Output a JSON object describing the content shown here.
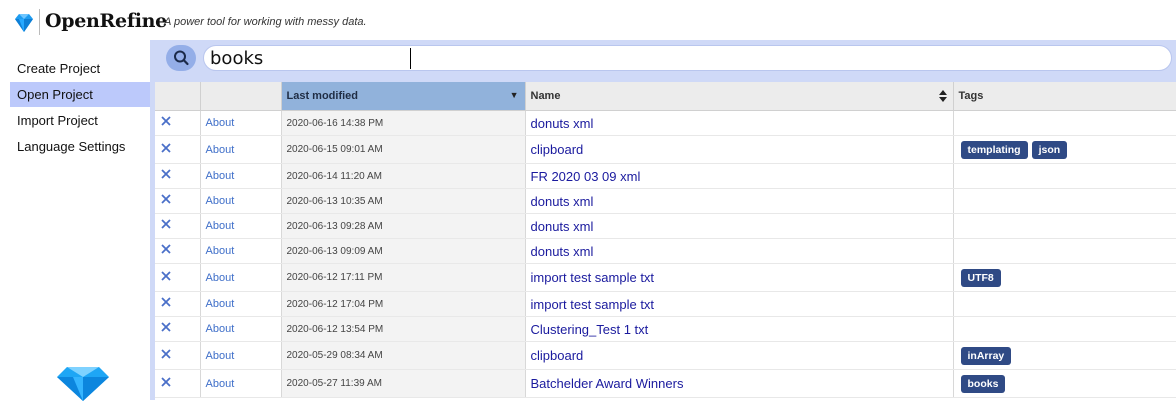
{
  "header": {
    "app_name": "OpenRefine",
    "tagline": "A power tool for working with messy data."
  },
  "sidebar": {
    "items": [
      {
        "label": "Create Project",
        "active": false
      },
      {
        "label": "Open Project",
        "active": true
      },
      {
        "label": "Import Project",
        "active": false
      },
      {
        "label": "Language Settings",
        "active": false
      }
    ]
  },
  "search": {
    "value": "books"
  },
  "table": {
    "columns": {
      "last_modified": "Last modified",
      "name": "Name",
      "tags": "Tags"
    },
    "about_label": "About",
    "rows": [
      {
        "date": "2020-06-16 14:38 PM",
        "name": "donuts xml",
        "tags": []
      },
      {
        "date": "2020-06-15 09:01 AM",
        "name": "clipboard",
        "tags": [
          "templating",
          "json"
        ]
      },
      {
        "date": "2020-06-14 11:20 AM",
        "name": "FR 2020 03 09 xml",
        "tags": []
      },
      {
        "date": "2020-06-13 10:35 AM",
        "name": "donuts xml",
        "tags": []
      },
      {
        "date": "2020-06-13 09:28 AM",
        "name": "donuts xml",
        "tags": []
      },
      {
        "date": "2020-06-13 09:09 AM",
        "name": "donuts xml",
        "tags": []
      },
      {
        "date": "2020-06-12 17:11 PM",
        "name": "import test sample txt",
        "tags": [
          "UTF8"
        ]
      },
      {
        "date": "2020-06-12 17:04 PM",
        "name": "import test sample txt",
        "tags": []
      },
      {
        "date": "2020-06-12 13:54 PM",
        "name": "Clustering_Test 1 txt",
        "tags": []
      },
      {
        "date": "2020-05-29 08:34 AM",
        "name": "clipboard",
        "tags": [
          "inArray"
        ]
      },
      {
        "date": "2020-05-27 11:39 AM",
        "name": "Batchelder Award Winners",
        "tags": [
          "books"
        ]
      }
    ]
  },
  "colors": {
    "accent": "#bcc9fb",
    "search_bar": "#cfd9f7",
    "sorted_header": "#91b2db",
    "tag": "#2f4a85",
    "link": "#1a1a9e",
    "delete": "#4a6fc8"
  },
  "icons": {
    "logo": "diamond-icon",
    "search": "search-icon",
    "delete": "close-icon",
    "sort_desc": "triangle-down-icon",
    "sort_both": "sort-icon"
  }
}
